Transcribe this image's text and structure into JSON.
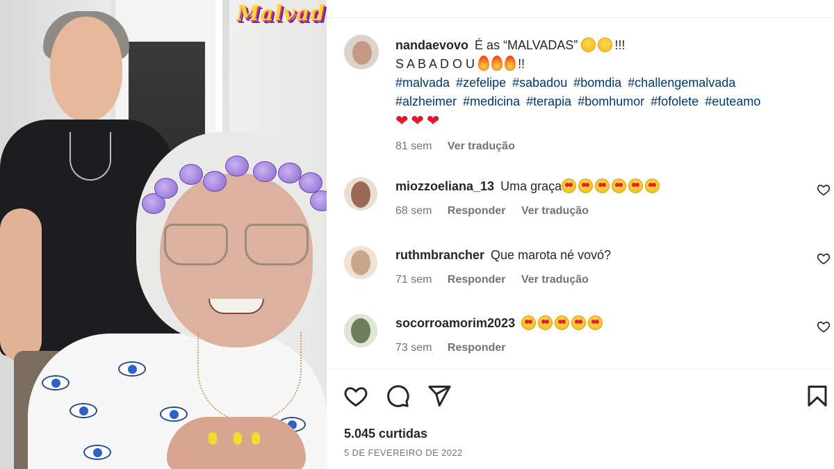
{
  "media": {
    "logo_text": "Malvada"
  },
  "post": {
    "author": "nandaevovo",
    "caption_text": "É as “MALVADAS”",
    "caption_suffix": "!!!",
    "line2_text": "S A B A D O U",
    "line2_suffix": "!!",
    "hashtags_line1": [
      "#malvada",
      "#zefelipe",
      "#sabadou",
      "#bomdia",
      "#challengemalvada"
    ],
    "hashtags_line2": [
      "#alzheimer",
      "#medicina",
      "#terapia",
      "#bomhumor",
      "#fofolete",
      "#euteamo"
    ],
    "hearts": "❤❤❤",
    "time": "81 sem",
    "translate": "Ver tradução"
  },
  "comments": [
    {
      "user": "miozzoeliana_13",
      "text": "Uma graça",
      "emoji_count": 6,
      "time": "68 sem",
      "reply": "Responder",
      "translate": "Ver tradução",
      "avatar_color": "#9a6a55"
    },
    {
      "user": "ruthmbrancher",
      "text": "Que marota né vovó?",
      "emoji_count": 0,
      "time": "71 sem",
      "reply": "Responder",
      "translate": "Ver tradução",
      "avatar_color": "#c9a58a"
    },
    {
      "user": "socorroamorim2023",
      "text": "",
      "emoji_count": 5,
      "time": "73 sem",
      "reply": "Responder",
      "translate": "",
      "avatar_color": "#6e7d5a"
    }
  ],
  "actions": {
    "like_icon": "heart-icon",
    "comment_icon": "comment-icon",
    "share_icon": "send-icon",
    "save_icon": "bookmark-icon"
  },
  "likes": "5.045 curtidas",
  "date": "5 DE FEVEREIRO DE 2022"
}
